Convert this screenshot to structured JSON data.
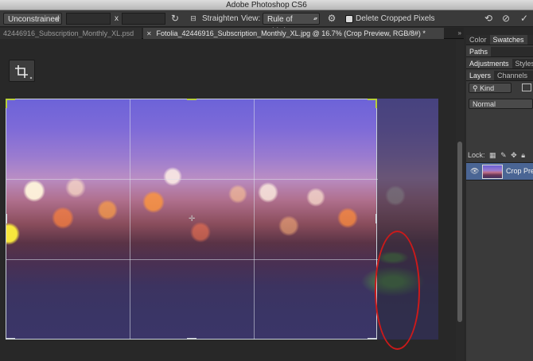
{
  "window": {
    "title": "Adobe Photoshop CS6"
  },
  "options_bar": {
    "ratio_preset": "Unconstrained",
    "width_value": "",
    "separator": "x",
    "height_value": "",
    "straighten_label": "Straighten",
    "view_label": "View:",
    "view_value": "Rule of Thirds",
    "delete_cropped_label": "Delete Cropped Pixels",
    "delete_cropped_checked": false
  },
  "tabs": [
    {
      "label": "42446916_Subscription_Monthly_XL.psd",
      "active": false
    },
    {
      "label": "Fotolia_42446916_Subscription_Monthly_XL.jpg @ 16.7% (Crop Preview, RGB/8#) *",
      "active": true
    }
  ],
  "tabs_more": "»",
  "panels": {
    "group1_tabs": [
      "Color",
      "Swatches"
    ],
    "group2_tabs": [
      "Paths"
    ],
    "group3_tabs": [
      "Adjustments",
      "Styles"
    ],
    "layers_tabs": [
      "Layers",
      "Channels"
    ],
    "filter_kind": "Kind",
    "blend_mode": "Normal",
    "lock_label": "Lock:",
    "layers": [
      {
        "name": "Crop Preview",
        "visible": true,
        "selected": true
      }
    ]
  },
  "colors": {
    "crop_handle": "#b7cf3a",
    "highlight_oval": "#cc1a1a",
    "selected_layer": "#4a6594"
  }
}
